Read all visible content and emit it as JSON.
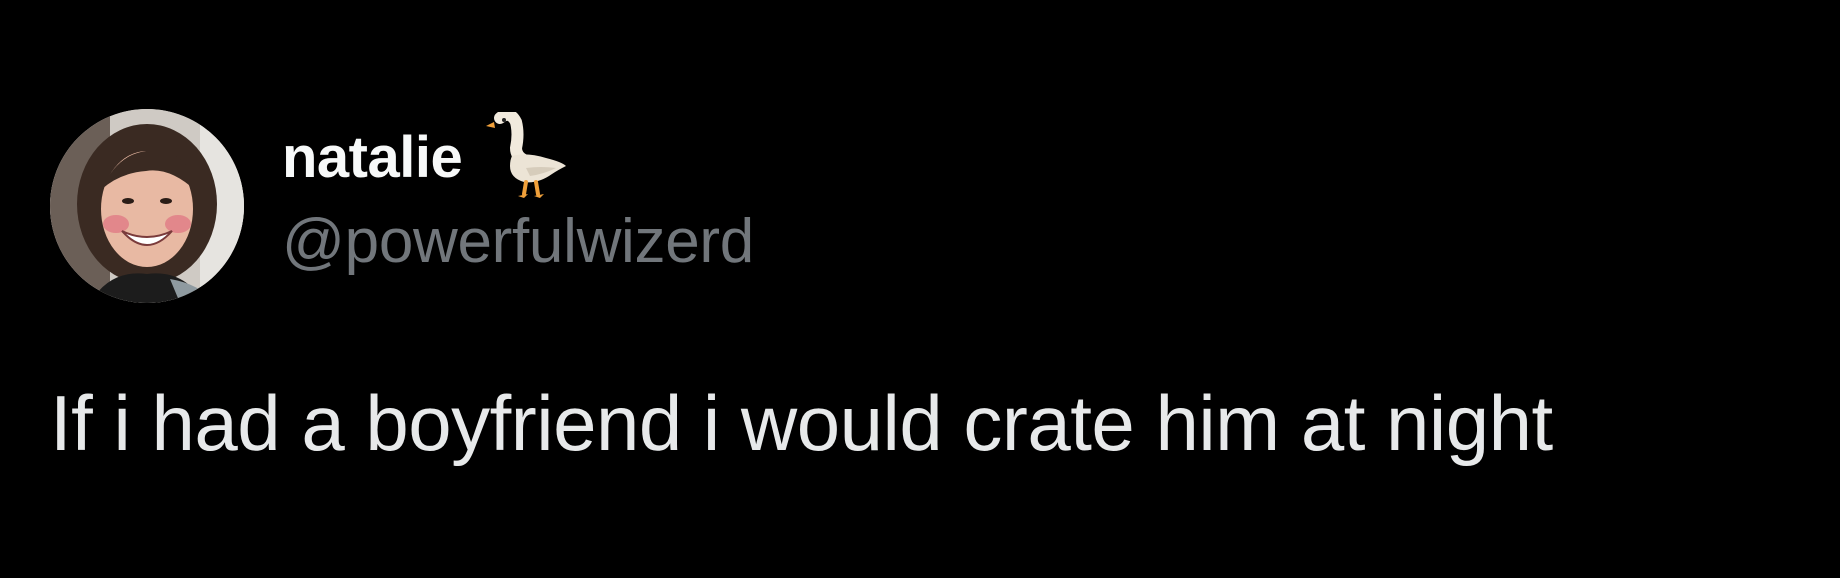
{
  "tweet": {
    "author": {
      "display_name": "natalie",
      "emoji_icon": "goose-icon",
      "handle": "@powerfulwizerd"
    },
    "text": "If i had a boyfriend i would crate him at night"
  },
  "colors": {
    "background": "#000000",
    "name": "#f7f9f9",
    "handle": "#71767b",
    "body_text": "#e7e9ea"
  }
}
